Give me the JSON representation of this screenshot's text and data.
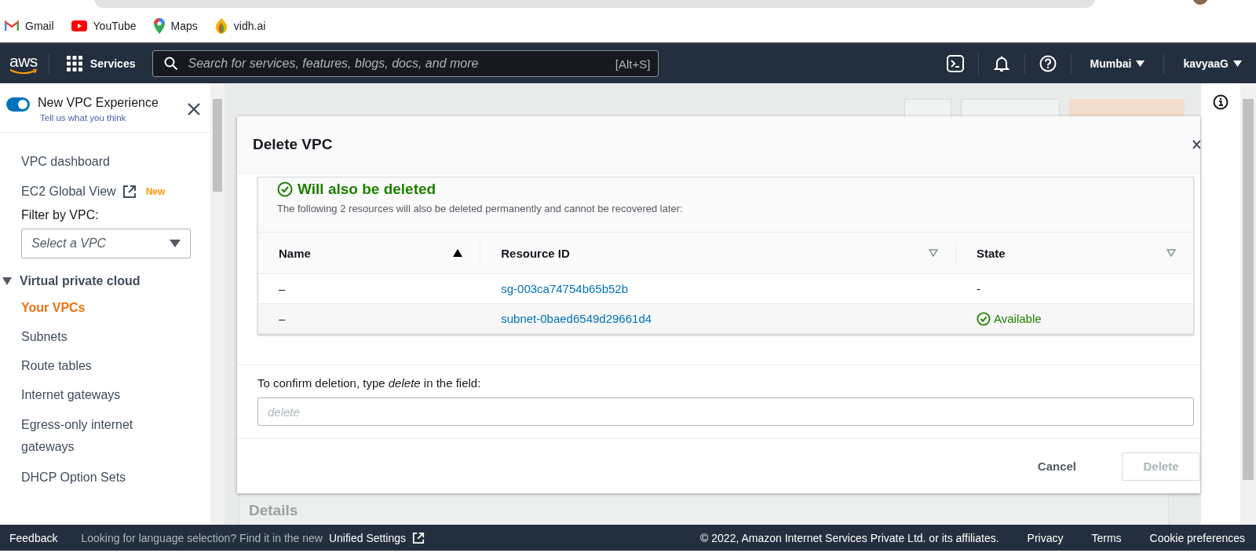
{
  "bookmarks": [
    {
      "label": "Gmail",
      "kind": "mail"
    },
    {
      "label": "YouTube",
      "kind": "video"
    },
    {
      "label": "Maps",
      "kind": "map"
    },
    {
      "label": "vidh.ai",
      "kind": "flame"
    }
  ],
  "navbar": {
    "logo": "aws",
    "services": "Services",
    "search": {
      "placeholder": "Search for services, features, blogs, docs, and more",
      "shortcut": "[Alt+S]"
    },
    "region": "Mumbai",
    "user": "kavyaaG"
  },
  "sidebar": {
    "toggle": {
      "label": "New VPC Experience",
      "on": true
    },
    "feedback_link": "Tell us what you think",
    "items": [
      {
        "label": "VPC dashboard",
        "external": false,
        "selected": false
      },
      {
        "label": "EC2 Global View",
        "external": true,
        "badge": "New",
        "selected": false
      }
    ],
    "filter": {
      "label": "Filter by VPC:",
      "placeholder": "Select a VPC"
    },
    "section": {
      "label": "Virtual private cloud",
      "expanded": true,
      "children": [
        {
          "label": "Your VPCs",
          "selected": true
        },
        {
          "label": "Subnets",
          "selected": false
        },
        {
          "label": "Route tables",
          "selected": false
        },
        {
          "label": "Internet gateways",
          "selected": false
        },
        {
          "label": "Egress-only internet gateways",
          "selected": false
        },
        {
          "label": "DHCP Option Sets",
          "selected": false
        }
      ]
    }
  },
  "background": {
    "details_heading": "Details"
  },
  "modal": {
    "title": "Delete VPC",
    "heading": "Will also be deleted",
    "description": "The following 2 resources will also be deleted permanently and cannot be recovered later:",
    "columns": [
      {
        "label": "Name",
        "sorted": true
      },
      {
        "label": "Resource ID",
        "sorted": false
      },
      {
        "label": "State",
        "sorted": false
      }
    ],
    "rows": [
      {
        "name": "–",
        "resource_id": "sg-003ca74754b65b52b",
        "state": "-",
        "ok": false
      },
      {
        "name": "–",
        "resource_id": "subnet-0baed6549d29661d4",
        "state": "Available",
        "ok": true
      }
    ],
    "confirm_label": "To confirm deletion, type *delete* in the field:",
    "input": {
      "placeholder": "delete"
    },
    "buttons": [
      {
        "label": "Cancel",
        "kind": "link",
        "disabled": false
      },
      {
        "label": "Delete",
        "kind": "primary",
        "disabled": true
      }
    ]
  },
  "footer": {
    "feedback": "Feedback",
    "language_note": "Looking for language selection? Find it in the new",
    "settings_link": "Unified Settings",
    "copyright": "© 2022, Amazon Internet Services Private Ltd. or its affiliates.",
    "links": [
      "Privacy",
      "Terms",
      "Cookie preferences"
    ]
  }
}
